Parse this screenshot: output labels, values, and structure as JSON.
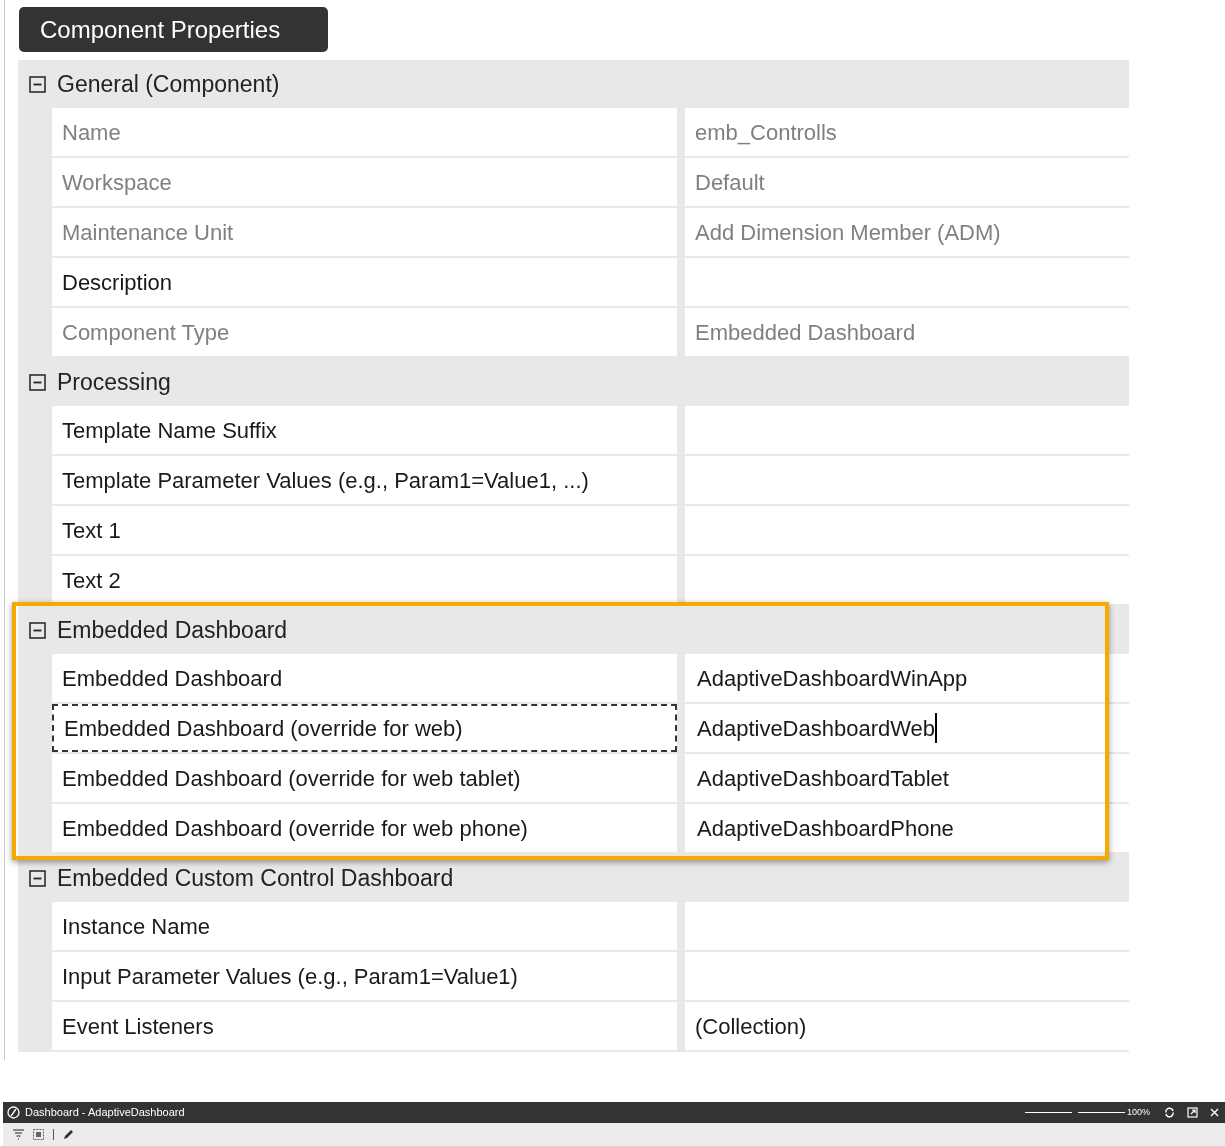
{
  "panel_title": "Component Properties",
  "categories": [
    {
      "name": "General (Component)",
      "expanded": true,
      "properties": [
        {
          "name": "Name",
          "value": "emb_Controlls",
          "readonly": true
        },
        {
          "name": "Workspace",
          "value": "Default",
          "readonly": true
        },
        {
          "name": "Maintenance Unit",
          "value": "Add Dimension Member (ADM)",
          "readonly": true
        },
        {
          "name": "Description",
          "readonly": false
        },
        {
          "name": "Component Type",
          "value": "Embedded Dashboard",
          "readonly": true
        }
      ]
    },
    {
      "name": "Processing",
      "expanded": true,
      "properties": [
        {
          "name": "Template Name Suffix",
          "readonly": false
        },
        {
          "name": "Template Parameter Values (e.g., Param1=Value1, ...)",
          "readonly": false
        },
        {
          "name": "Text 1",
          "readonly": false
        },
        {
          "name": "Text 2",
          "readonly": false
        }
      ]
    },
    {
      "name": "Embedded Dashboard",
      "expanded": true,
      "highlighted": true,
      "properties": [
        {
          "name": "Embedded Dashboard",
          "value": "AdaptiveDashboardWinApp",
          "readonly": false
        },
        {
          "name": "Embedded Dashboard (override for web)",
          "value": "AdaptiveDashboardWeb",
          "readonly": false,
          "focused": true,
          "caret": true
        },
        {
          "name": "Embedded Dashboard (override for web tablet)",
          "value": "AdaptiveDashboardTablet",
          "readonly": false
        },
        {
          "name": "Embedded Dashboard (override for web phone)",
          "value": "AdaptiveDashboardPhone",
          "readonly": false
        }
      ]
    },
    {
      "name": "Embedded Custom Control Dashboard",
      "expanded": true,
      "properties": [
        {
          "name": "Instance Name",
          "readonly": false
        },
        {
          "name": "Input Parameter Values (e.g., Param1=Value1)",
          "readonly": false
        },
        {
          "name": "Event Listeners",
          "value": "(Collection)",
          "readonly": false
        }
      ]
    }
  ],
  "dashboard_window": {
    "title": "Dashboard - AdaptiveDashboard",
    "zoom": {
      "level": 0.5,
      "reading": "100%"
    }
  }
}
